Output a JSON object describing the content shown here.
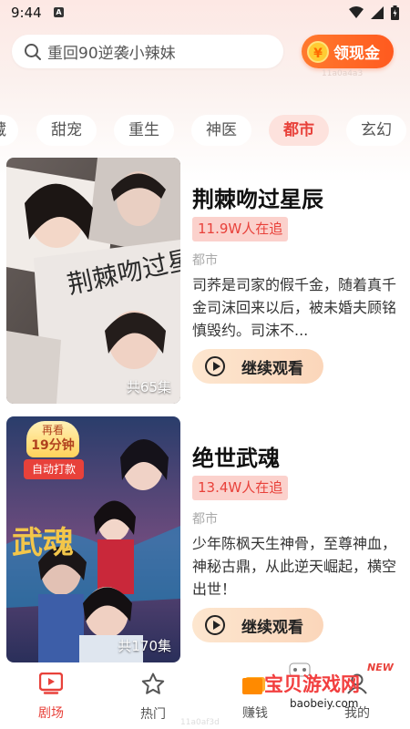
{
  "status_bar": {
    "time": "9:44",
    "notif_icon": "A"
  },
  "search": {
    "placeholder": "重回90逆袭小辣妹"
  },
  "cash_button": {
    "label": "领现金",
    "sub_text": "11a0a4a3"
  },
  "tabs": [
    {
      "label": "试藏",
      "active": false
    },
    {
      "label": "甜宠",
      "active": false
    },
    {
      "label": "重生",
      "active": false
    },
    {
      "label": "神医",
      "active": false
    },
    {
      "label": "都市",
      "active": true
    },
    {
      "label": "玄幻",
      "active": false
    }
  ],
  "dramas": [
    {
      "title": "荆棘吻过星辰",
      "heat": "11.9W人在追",
      "genre": "都市",
      "description": "司荞是司家的假千金，随着真千金司沫回来以后，被未婚夫顾铭慎毁约。司沫不...",
      "episodes": "共65集",
      "poster_text": "荆棘吻过星辰",
      "button_label": "继续观看"
    },
    {
      "title": "绝世武魂",
      "heat": "13.4W人在追",
      "genre": "都市",
      "description": "少年陈枫天生神骨，至尊神血，神秘古鼎，从此逆天崛起，横空出世！",
      "episodes": "共170集",
      "poster_text": "武魂",
      "button_label": "继续观看",
      "badge": {
        "line1": "再看",
        "line2": "19分钟",
        "line3": "自动打款"
      }
    }
  ],
  "bottom_nav": {
    "items": [
      {
        "label": "剧场",
        "icon": "theater-icon",
        "active": true
      },
      {
        "label": "热门",
        "icon": "star-icon",
        "active": false
      },
      {
        "label": "赚钱",
        "icon": "money-icon",
        "active": false
      },
      {
        "label": "我的",
        "icon": "profile-icon",
        "active": false
      }
    ],
    "sub_text": "11a0af3d"
  },
  "watermark": {
    "text": "宝贝游戏网",
    "url": "baobeiy.com",
    "tag": "NEW"
  },
  "colors": {
    "accent": "#e8413a",
    "cash_orange": "#ff6a24",
    "heat_bg": "#fbd1cc"
  }
}
